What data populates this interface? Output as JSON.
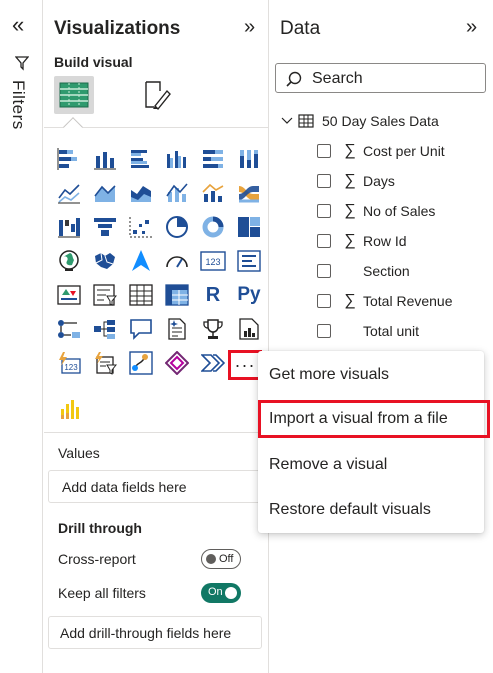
{
  "filters": {
    "label": "Filters",
    "collapse_icon": "double-chevron-left-icon",
    "icon": "funnel-icon"
  },
  "visualizations": {
    "title": "Visualizations",
    "expand_icon": "double-chevron-right-icon",
    "build_visual_label": "Build visual",
    "tabs": [
      "build-visual-tab",
      "format-visual-tab"
    ],
    "more_visuals_label": "···",
    "values_label": "Values",
    "values_placeholder": "Add data fields here",
    "drill_through_label": "Drill through",
    "cross_report_label": "Cross-report",
    "cross_report_toggle": "Off",
    "keep_filters_label": "Keep all filters",
    "keep_filters_toggle": "On",
    "drill_placeholder": "Add drill-through fields here"
  },
  "data_pane": {
    "title": "Data",
    "expand_icon": "double-chevron-right-icon",
    "search_placeholder": "Search",
    "table_name": "50 Day Sales Data",
    "fields": [
      {
        "name": "Cost per Unit",
        "sigma": true
      },
      {
        "name": "Days",
        "sigma": true
      },
      {
        "name": "No of Sales",
        "sigma": true
      },
      {
        "name": "Row Id",
        "sigma": true
      },
      {
        "name": "Section",
        "sigma": false
      },
      {
        "name": "Total Revenue",
        "sigma": true
      },
      {
        "name": "Total unit",
        "sigma": false
      }
    ]
  },
  "context_menu": {
    "items": [
      "Get more visuals",
      "Import a visual from a file",
      "Remove a visual",
      "Restore default visuals"
    ],
    "highlighted_index": 1
  },
  "colors": {
    "accent_blue": "#118dff",
    "toggle_on": "#117865",
    "highlight_red": "#e81123"
  }
}
